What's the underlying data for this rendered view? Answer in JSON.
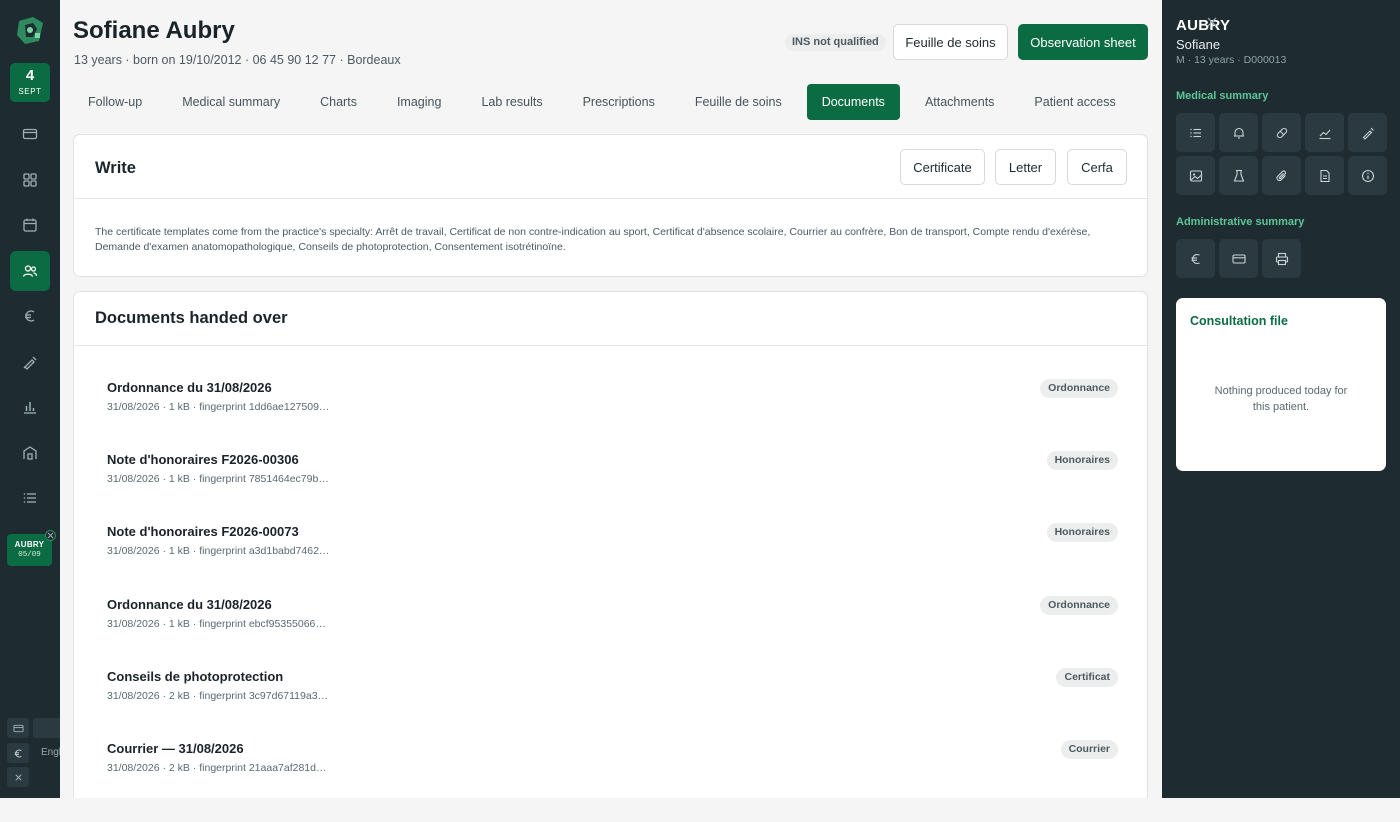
{
  "rail": {
    "date_day": "4",
    "date_month": "SEPT",
    "open_patient": {
      "name": "AUBRY",
      "date": "05/09"
    },
    "language": "English"
  },
  "header": {
    "patient_name": "Sofiane Aubry",
    "patient_sub": "13 years · born on 19/10/2012 · 06 45 90 12 77 · Bordeaux",
    "ins_status": "INS not qualified",
    "care_sheet_button": "Feuille de soins",
    "observation_button": "Observation sheet"
  },
  "tabs": [
    {
      "label": "Follow-up"
    },
    {
      "label": "Medical summary"
    },
    {
      "label": "Charts"
    },
    {
      "label": "Imaging"
    },
    {
      "label": "Lab results"
    },
    {
      "label": "Prescriptions"
    },
    {
      "label": "Feuille de soins"
    },
    {
      "label": "Documents",
      "active": true
    },
    {
      "label": "Attachments"
    },
    {
      "label": "Patient access"
    }
  ],
  "write": {
    "title": "Write",
    "certificate_button": "Certificate",
    "letter_button": "Letter",
    "cerfa_button": "Cerfa",
    "note": "The certificate templates come from the practice's specialty: Arrêt de travail, Certificat de non contre-indication au sport, Certificat d'absence scolaire, Courrier au confrère, Bon de transport, Compte rendu d'exérèse, Demande d'examen anatomopathologique, Conseils de photoprotection, Consentement isotrétinoïne."
  },
  "documents": {
    "title": "Documents handed over",
    "items": [
      {
        "title": "Ordonnance du 31/08/2026",
        "meta": "31/08/2026 · 1 kB · fingerprint 1dd6ae127509…",
        "tag": "Ordonnance"
      },
      {
        "title": "Note d'honoraires F2026-00306",
        "meta": "31/08/2026 · 1 kB · fingerprint 7851464ec79b…",
        "tag": "Honoraires"
      },
      {
        "title": "Note d'honoraires F2026-00073",
        "meta": "31/08/2026 · 1 kB · fingerprint a3d1babd7462…",
        "tag": "Honoraires"
      },
      {
        "title": "Ordonnance du 31/08/2026",
        "meta": "31/08/2026 · 1 kB · fingerprint ebcf95355066…",
        "tag": "Ordonnance"
      },
      {
        "title": "Conseils de photoprotection",
        "meta": "31/08/2026 · 2 kB · fingerprint 3c97d67119a3…",
        "tag": "Certificat"
      },
      {
        "title": "Courrier — 31/08/2026",
        "meta": "31/08/2026 · 2 kB · fingerprint 21aaa7af281d…",
        "tag": "Courrier"
      }
    ]
  },
  "right_panel": {
    "last_name": "AUBRY",
    "first_name": "Sofiane",
    "meta": "M · 13 years · D000013",
    "medical_summary_title": "Medical summary",
    "medical_icons": [
      "list-icon",
      "bell-icon",
      "pill-icon",
      "trend-chart-icon",
      "syringe-icon",
      "image-icon",
      "flask-icon",
      "paperclip-icon",
      "document-icon",
      "info-icon"
    ],
    "administrative_summary_title": "Administrative summary",
    "admin_icons": [
      "euro-icon",
      "card-icon",
      "printer-icon"
    ],
    "consultation_title": "Consultation file",
    "consultation_empty": "Nothing produced today for this patient."
  },
  "colors": {
    "brand": "#0b6c43",
    "rail": "#1e2c31",
    "accent_text": "#5ec596"
  }
}
